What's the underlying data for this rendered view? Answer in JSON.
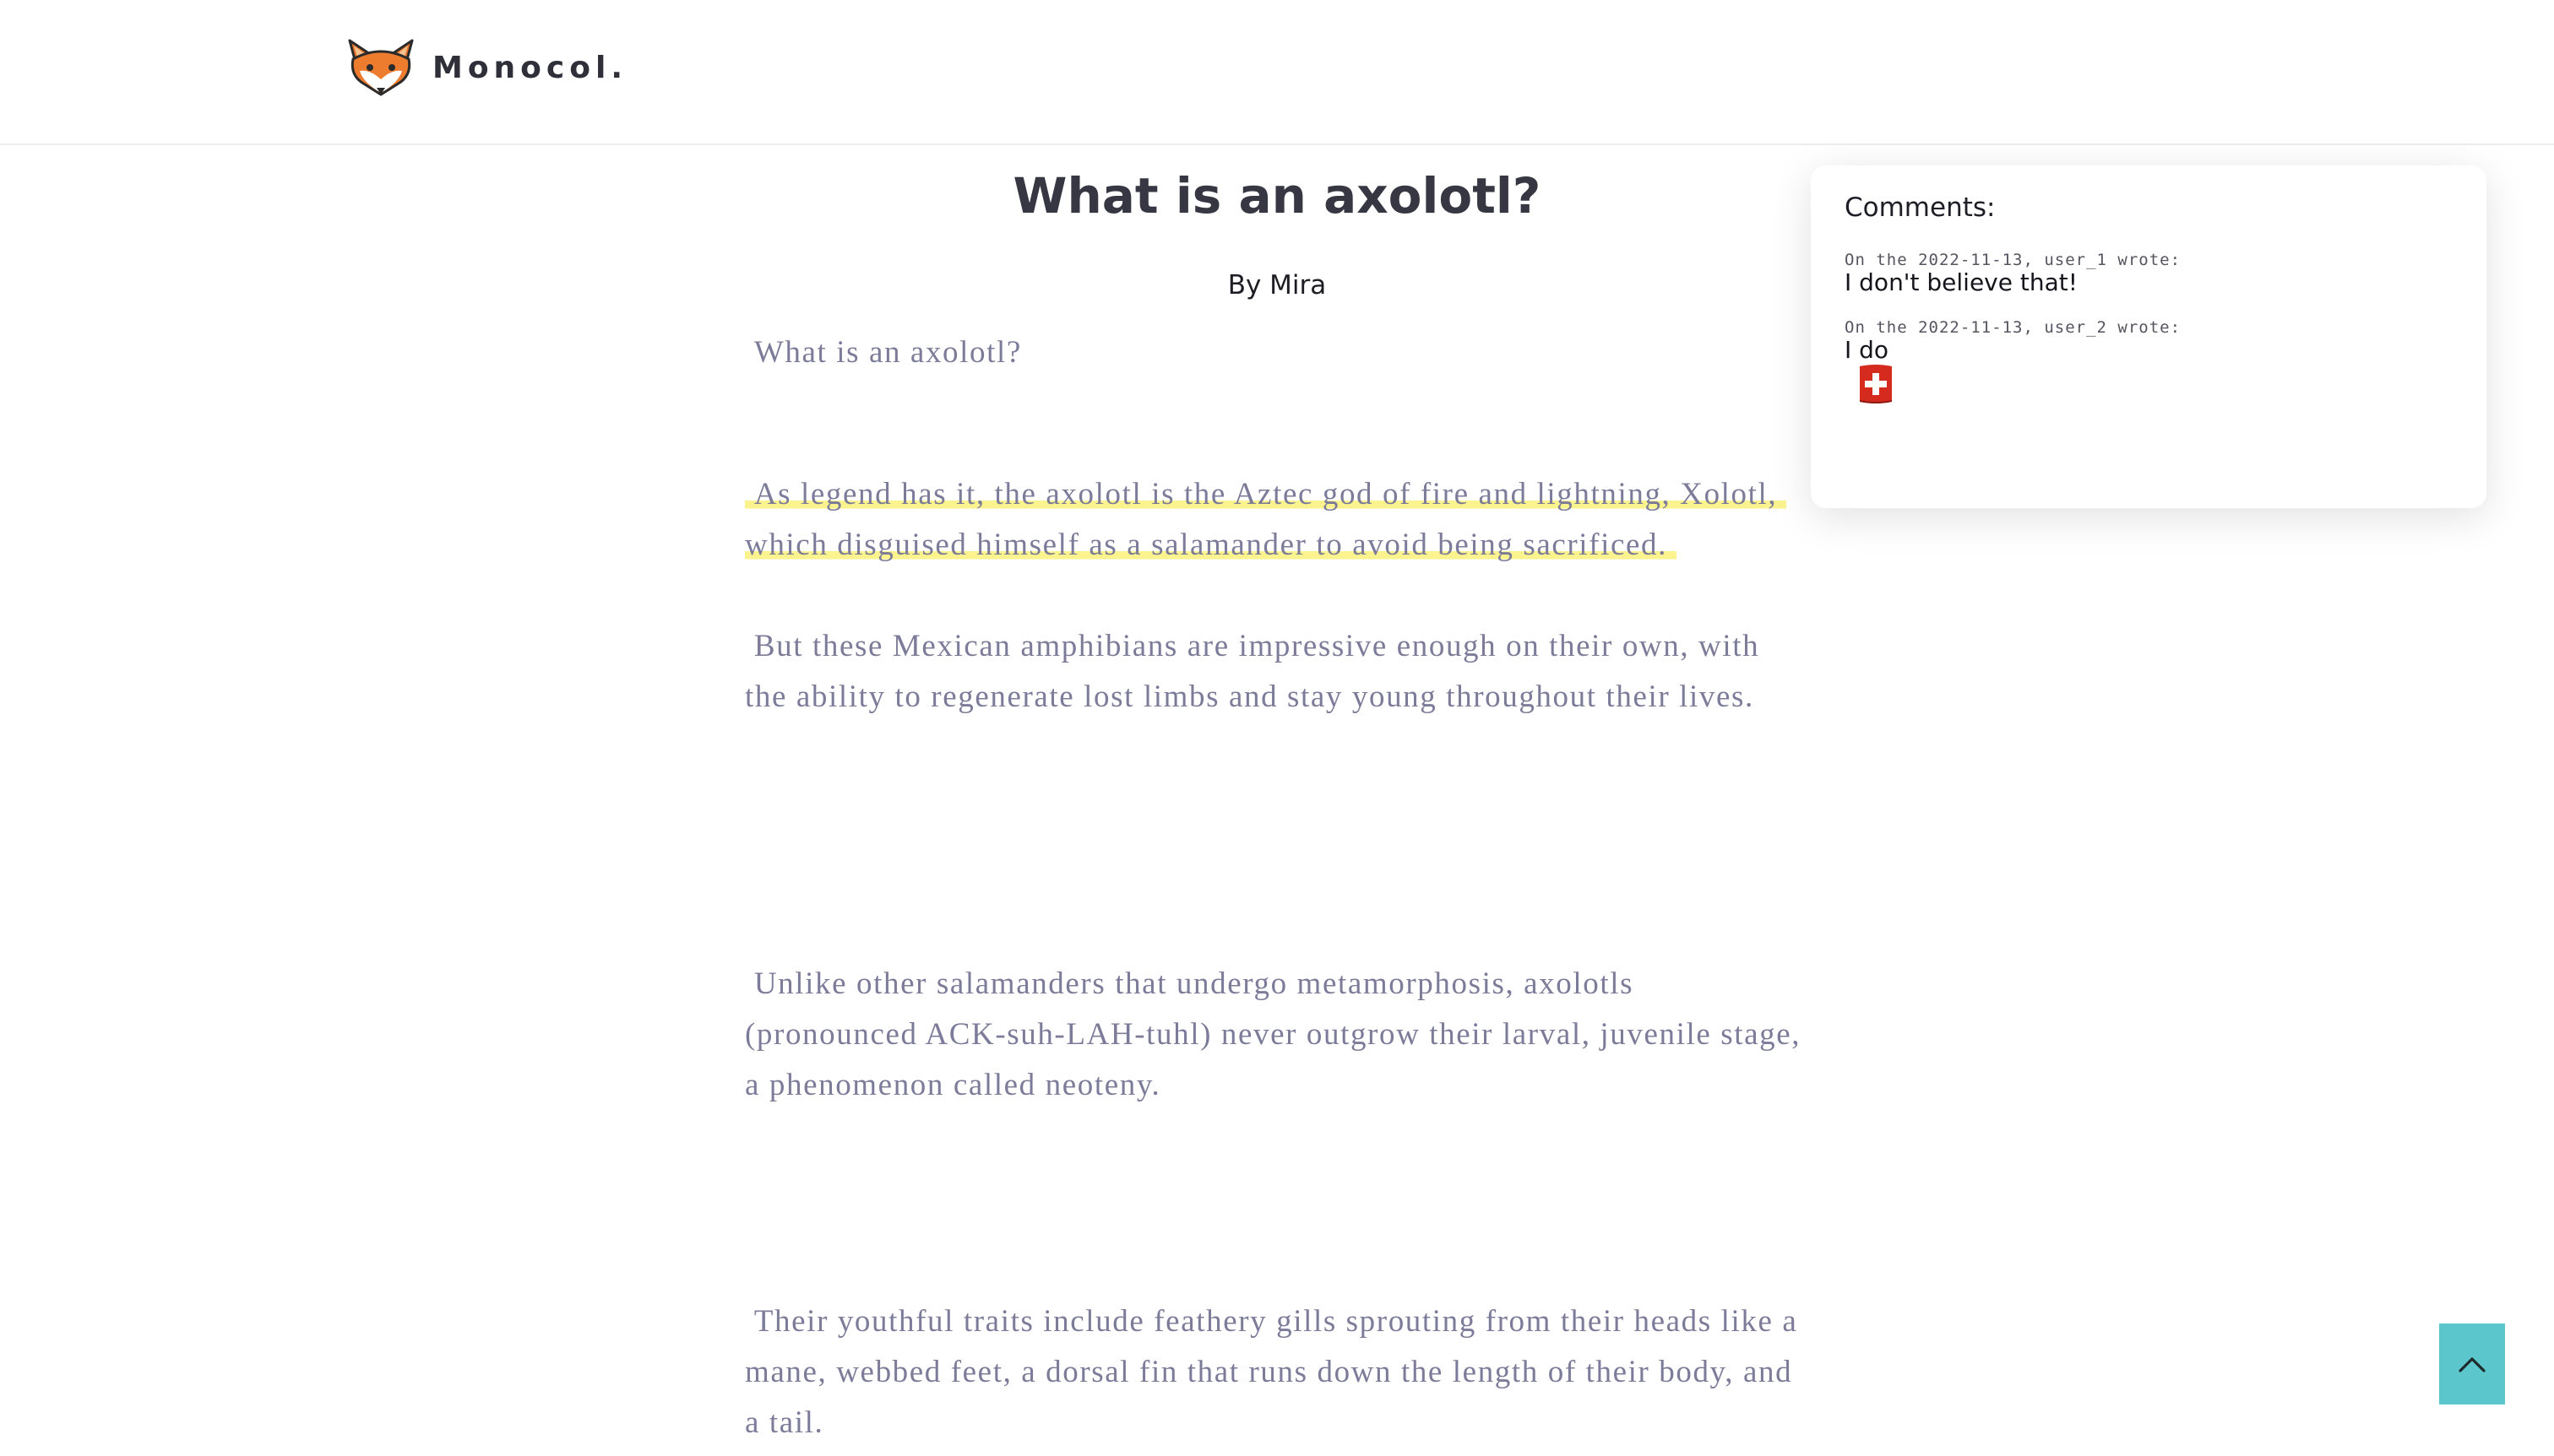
{
  "header": {
    "brand_name": "Monocol.",
    "logo_icon": "fox-logo-icon"
  },
  "article": {
    "title": "What is an axolotl?",
    "author": "By Mira",
    "paragraphs": [
      " What is an axolotl?",
      " As legend has it, the axolotl is the Aztec god of fire and lightning, Xolotl, which disguised himself as a salamander to avoid being sacrificed. ",
      " But these Mexican amphibians are impressive enough on their own, with the ability to regenerate lost limbs and stay young throughout their lives.",
      " Unlike other salamanders that undergo metamorphosis, axolotls (pronounced ACK-suh-LAH-tuhl) never outgrow their larval, juvenile stage, a phenomenon called neoteny.",
      " Their youthful traits include feathery gills sprouting from their heads like a mane, webbed feet, a dorsal fin that runs down the length of their body, and a tail."
    ],
    "highlight_color": "#fbf38e"
  },
  "comments": {
    "title": "Comments:",
    "items": [
      {
        "meta": "On the 2022-11-13, user_1 wrote:",
        "text": "I don't believe that!"
      },
      {
        "meta": "On the 2022-11-13, user_2 wrote:",
        "text": "I do",
        "emoji_icon": "swiss-flag-icon"
      }
    ]
  },
  "scroll_top": {
    "icon": "chevron-up-icon",
    "color": "#5bc7cc"
  }
}
